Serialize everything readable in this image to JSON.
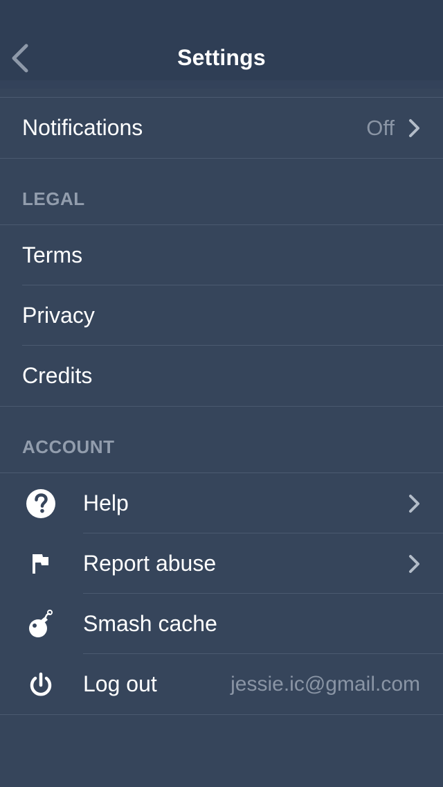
{
  "nav": {
    "title": "Settings",
    "back_icon": "chevron-left-icon"
  },
  "notifications": {
    "label": "Notifications",
    "value": "Off"
  },
  "legal": {
    "header": "LEGAL",
    "items": [
      {
        "label": "Terms"
      },
      {
        "label": "Privacy"
      },
      {
        "label": "Credits"
      }
    ]
  },
  "account": {
    "header": "ACCOUNT",
    "items": [
      {
        "label": "Help",
        "icon": "help-icon"
      },
      {
        "label": "Report abuse",
        "icon": "flag-icon"
      },
      {
        "label": "Smash cache",
        "icon": "bomb-icon"
      },
      {
        "label": "Log out",
        "icon": "power-icon",
        "value": "jessie.ic@gmail.com"
      }
    ]
  },
  "colors": {
    "background": "#36455b",
    "nav_background": "#2f3e55",
    "separator": "#4b5a70",
    "secondary_text": "#8a95a5",
    "section_header": "#929dad"
  }
}
